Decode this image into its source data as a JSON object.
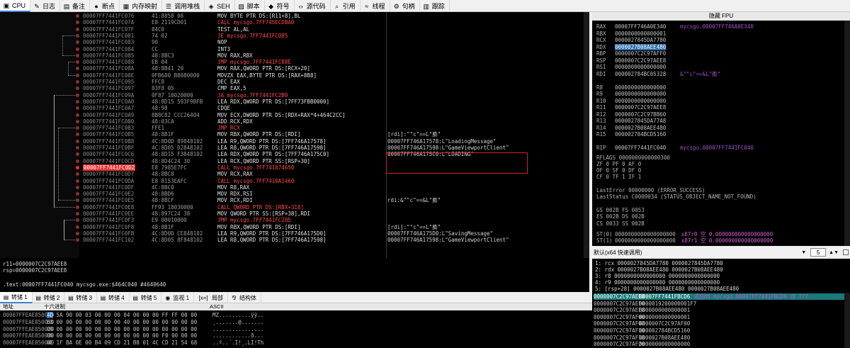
{
  "tabs": [
    {
      "label": "CPU",
      "icon": "cpu-icon",
      "glyph": "▣",
      "active": true
    },
    {
      "label": "日志",
      "icon": "log-icon",
      "glyph": "✎"
    },
    {
      "label": "备注",
      "icon": "notes-icon",
      "glyph": "▤"
    },
    {
      "label": "断点",
      "icon": "breakpoint-icon",
      "glyph": "●"
    },
    {
      "label": "内存映射",
      "icon": "memory-map-icon",
      "glyph": "▦"
    },
    {
      "label": "调用堆栈",
      "icon": "call-stack-icon",
      "glyph": "☰"
    },
    {
      "label": "SEH",
      "icon": "seh-icon",
      "glyph": "◈"
    },
    {
      "label": "脚本",
      "icon": "script-icon",
      "glyph": "▧"
    },
    {
      "label": "符号",
      "icon": "symbols-icon",
      "glyph": "◆"
    },
    {
      "label": "源代码",
      "icon": "source-icon",
      "glyph": "‹›"
    },
    {
      "label": "引用",
      "icon": "references-icon",
      "glyph": "⌕"
    },
    {
      "label": "线程",
      "icon": "threads-icon",
      "glyph": "≈"
    },
    {
      "label": "句柄",
      "icon": "handles-icon",
      "glyph": "⚙"
    },
    {
      "label": "跟踪",
      "icon": "trace-icon",
      "glyph": "▥"
    }
  ],
  "disasm": [
    {
      "addr": "00007FF7441FC076",
      "bytes": "41:8858 08",
      "asm": [
        [
          "m",
          "MOV BYTE PTR DS:[R11+8],BL"
        ]
      ],
      "cmt": ""
    },
    {
      "addr": "00007FF7441FC07A",
      "bytes": "E8 2119CD01",
      "asm": [
        [
          "red",
          "CALL mycsgo.7FF745ECDBA0"
        ]
      ],
      "cmt": ""
    },
    {
      "addr": "00007FF7441FC07F",
      "bytes": "84C0",
      "asm": [
        [
          "m",
          "TEST AL,AL"
        ]
      ],
      "cmt": ""
    },
    {
      "addr": "00007FF7441FC081",
      "bytes": "74 02",
      "asm": [
        [
          "red",
          "JE mycsgo.7FF7441FC085"
        ]
      ],
      "cmt": ""
    },
    {
      "addr": "00007FF7441FC083",
      "bytes": "90",
      "asm": [
        [
          "m",
          "NOP"
        ]
      ],
      "cmt": ""
    },
    {
      "addr": "00007FF7441FC084",
      "bytes": "CC",
      "asm": [
        [
          "m",
          "INT3"
        ]
      ],
      "cmt": ""
    },
    {
      "addr": "00007FF7441FC085",
      "bytes": "48:8BC3",
      "asm": [
        [
          "m",
          "MOV RAX,RBX"
        ]
      ],
      "cmt": ""
    },
    {
      "addr": "00007FF7441FC088",
      "bytes": "EB 04",
      "asm": [
        [
          "red",
          "JMP mycsgo.7FF7441FC08E"
        ]
      ],
      "cmt": ""
    },
    {
      "addr": "00007FF7441FC08A",
      "bytes": "48:8B41 20",
      "asm": [
        [
          "m",
          "MOV RAX,QWORD PTR DS:[RCX+20]"
        ]
      ],
      "cmt": ""
    },
    {
      "addr": "00007FF7441FC08E",
      "bytes": "0FB680 B8080000",
      "asm": [
        [
          "m",
          "MOVZX EAX,BYTE PTR DS:[RAX+8B8]"
        ]
      ],
      "cmt": ""
    },
    {
      "addr": "00007FF7441FC095",
      "bytes": "FFC8",
      "asm": [
        [
          "m",
          "DEC EAX"
        ]
      ],
      "cmt": ""
    },
    {
      "addr": "00007FF7441FC097",
      "bytes": "83F8 05",
      "asm": [
        [
          "m",
          "CMP EAX,5"
        ]
      ],
      "cmt": ""
    },
    {
      "addr": "00007FF7441FC09A",
      "bytes": "0F87 10020000",
      "asm": [
        [
          "red",
          "JA mycsgo.7FF7441FC2B0"
        ]
      ],
      "cmt": ""
    },
    {
      "addr": "00007FF7441FC0A0",
      "bytes": "48:8D15 593F9BFB",
      "asm": [
        [
          "m",
          "LEA RDX,QWORD PTR DS:[7FF73FBB0000]"
        ]
      ],
      "cmt": ""
    },
    {
      "addr": "00007FF7441FC0A7",
      "bytes": "48:98",
      "asm": [
        [
          "m",
          "CDQE"
        ]
      ],
      "cmt": ""
    },
    {
      "addr": "00007FF7441FC0A9",
      "bytes": "8B8C82 CCC26404",
      "asm": [
        [
          "m",
          "MOV ECX,DWORD PTR DS:[RDX+RAX*4+464C2CC]"
        ]
      ],
      "cmt": ""
    },
    {
      "addr": "00007FF7441FC0B0",
      "bytes": "48:03CA",
      "asm": [
        [
          "m",
          "ADD RCX,RDX"
        ]
      ],
      "cmt": ""
    },
    {
      "addr": "00007FF7441FC0B3",
      "bytes": "FFE1",
      "asm": [
        [
          "red",
          "JMP RCX"
        ]
      ],
      "cmt": ""
    },
    {
      "addr": "00007FF7441FC0B5",
      "bytes": "48:8B1F",
      "asm": [
        [
          "m",
          "MOV RBX,QWORD PTR DS:[RDI]"
        ]
      ],
      "cmt": "[rdi]:\"\"c\"==L\"膨\""
    },
    {
      "addr": "00007FF7441FC0B8",
      "bytes": "4C:8D0D 89848102",
      "asm": [
        [
          "m",
          "LEA R9,QWORD PTR DS:[7FF746A17578]"
        ]
      ],
      "cmt": "00007FF746A17578:L\"LoadingMessage\""
    },
    {
      "addr": "00007FF7441FC0BF",
      "bytes": "4C:8D05 D2848102",
      "asm": [
        [
          "m",
          "LEA R8,QWORD PTR DS:[7FF746A17598]"
        ]
      ],
      "cmt": "00007FF746A17598:L\"GameViewportClient\""
    },
    {
      "addr": "00007FF7441FC0C6",
      "bytes": "48:8D15 F3848102",
      "asm": [
        [
          "m",
          "LEA RDX,QWORD PTR DS:[7FF746A175C0]"
        ]
      ],
      "cmt": "00007FF746A175C0:L\"LOADING\""
    },
    {
      "addr": "00007FF7441FC0CD",
      "bytes": "48:8D4C24 30",
      "asm": [
        [
          "m",
          "LEA RCX,QWORD PTR SS:[RSP+30]"
        ]
      ],
      "cmt": ""
    },
    {
      "addr": "00007FF7441FC0D2",
      "bytes": "E8 7985E7FC",
      "asm": [
        [
          "red",
          "CALL mycsgo.7FF741074650"
        ]
      ],
      "cmt": "",
      "bp": true
    },
    {
      "addr": "00007FF7441FC0D7",
      "bytes": "48:8BC8",
      "asm": [
        [
          "m",
          "MOV RCX,RAX"
        ]
      ],
      "cmt": ""
    },
    {
      "addr": "00007FF7441FC0DA",
      "bytes": "E8 8153EAFC",
      "asm": [
        [
          "red",
          "CALL mycsgo.7FF7410A1460"
        ]
      ],
      "cmt": ""
    },
    {
      "addr": "00007FF7441FC0DF",
      "bytes": "4C:8BC0",
      "asm": [
        [
          "m",
          "MOV R8,RAX"
        ]
      ],
      "cmt": ""
    },
    {
      "addr": "00007FF7441FC0E2",
      "bytes": "48:8BD6",
      "asm": [
        [
          "m",
          "MOV RDX,RSI"
        ]
      ],
      "cmt": ""
    },
    {
      "addr": "00007FF7441FC0E5",
      "bytes": "48:8BCF",
      "asm": [
        [
          "m",
          "MOV RCX,RDI"
        ]
      ],
      "cmt": "rdi:&\"\"c\"==&L\"膨\""
    },
    {
      "addr": "00007FF7441FC0E8",
      "bytes": "FF93 18030000",
      "asm": [
        [
          "red",
          "CALL QWORD PTR DS:[RBX+318]"
        ]
      ],
      "cmt": ""
    },
    {
      "addr": "00007FF7441FC0EE",
      "bytes": "48:897C24 38",
      "asm": [
        [
          "m",
          "MOV QWORD PTR SS:[RSP+38],RDI"
        ]
      ],
      "cmt": ""
    },
    {
      "addr": "00007FF7441FC0F3",
      "bytes": "E9 00010000",
      "asm": [
        [
          "red",
          "JMP mycsgo.7FF7441FC205"
        ]
      ],
      "cmt": ""
    },
    {
      "addr": "00007FF7441FC0F8",
      "bytes": "48:8B1F",
      "asm": [
        [
          "m",
          "MOV RBX,QWORD PTR DS:[RDI]"
        ]
      ],
      "cmt": "[rdi]:\"\"c\"==L\"膨\""
    },
    {
      "addr": "00007FF7441FC0FB",
      "bytes": "4C:8D0D CE848102",
      "asm": [
        [
          "m",
          "LEA R9,QWORD PTR DS:[7FF746A175D0]"
        ]
      ],
      "cmt": "00007FF746A175D0:L\"SavingMessage\""
    },
    {
      "addr": "00007FF7441FC102",
      "bytes": "4C:8D05 8F848102",
      "asm": [
        [
          "m",
          "LEA R8,QWORD PTR DS:[7FF746A17598]"
        ]
      ],
      "cmt": "00007FF746A17598:L\"GameViewportClient\""
    }
  ],
  "info": [
    "r11=0000007C2C97AEE8",
    "rsp=0000007C2C97AEE8",
    "",
    ".text:00007FF7441FC040 mycsgo.exe:$464C040 #4640640"
  ],
  "regs_header": "隐藏 FPU",
  "regs": [
    {
      "n": "RAX",
      "v": "00007FF746A0E340",
      "c": "mycsgo.00007FF746A0E340"
    },
    {
      "n": "RBX",
      "v": "0000000000000001",
      "c": ""
    },
    {
      "n": "RCX",
      "v": "0000027845DA7780",
      "c": ""
    },
    {
      "n": "RDX",
      "v": "0000027B08AEE480",
      "c": "",
      "hl": true
    },
    {
      "n": "RBP",
      "v": "0000007C2C97AFF0",
      "c": ""
    },
    {
      "n": "RSP",
      "v": "0000007C2C97AEE8",
      "c": ""
    },
    {
      "n": "RSI",
      "v": "0000000000000000",
      "c": ""
    },
    {
      "n": "RDI",
      "v": "000002784BC05328",
      "c": "&\"\"c\"==&L\"膨\""
    },
    {
      "n": "",
      "v": "",
      "c": ""
    },
    {
      "n": "R8",
      "v": "0000000000000000",
      "c": ""
    },
    {
      "n": "R9",
      "v": "0000000000000000",
      "c": ""
    },
    {
      "n": "R10",
      "v": "0000000000000000",
      "c": ""
    },
    {
      "n": "R11",
      "v": "0000007C2C97AEE8",
      "c": ""
    },
    {
      "n": "R12",
      "v": "0000007C2C97BB60",
      "c": ""
    },
    {
      "n": "R13",
      "v": "0000027845DA77A8",
      "c": ""
    },
    {
      "n": "R14",
      "v": "0000027B08AEE480",
      "c": ""
    },
    {
      "n": "R15",
      "v": "000002784BCD5160",
      "c": ""
    },
    {
      "n": "",
      "v": "",
      "c": ""
    },
    {
      "n": "RIP",
      "v": "00007FF7441FC040",
      "c": "mycsgo.00007FF7441FC040"
    }
  ],
  "flags": [
    "RFLAGS   0000000000000300",
    "ZF 0  PF 0  AF 0",
    "OF 0  SF 0  DF 0",
    "CF 0  TF 1  IF 1",
    "",
    "LastError  00000000 (ERROR_SUCCESS)",
    "LastStatus C0000034 (STATUS_OBJECT_NAME_NOT_FOUND)",
    "",
    "GS 002B  FS 0053",
    "ES 002B  DS 002B",
    "CS 0033  SS 002B"
  ],
  "st": [
    {
      "n": "ST(0)",
      "v": "0000000000000000000",
      "s": "x87r0 空 0.000000000000000000"
    },
    {
      "n": "ST(1)",
      "v": "0000000000000000000",
      "s": "x87r1 空 0.000000000000000000"
    }
  ],
  "callconv": {
    "label": "默认(x64 快速调用)",
    "spin": "5"
  },
  "args": [
    "1: rcx 0000027845DA7780 0000027845DA7780",
    "2: rdx 0000027B08AEE480 0000027B08AEE480",
    "3: r8 0000000000000000 0000000000000000",
    "4: r9 0000000000000000 0000000000000000",
    "5: [rsp+28] 0000027B08AEE480 0000027B08AEE480"
  ],
  "btabs": [
    {
      "label": "转储 1",
      "icon": "dump-icon",
      "glyph": "▤",
      "active": true
    },
    {
      "label": "转储 2",
      "icon": "dump-icon",
      "glyph": "▤"
    },
    {
      "label": "转储 3",
      "icon": "dump-icon",
      "glyph": "▤"
    },
    {
      "label": "转储 4",
      "icon": "dump-icon",
      "glyph": "▤"
    },
    {
      "label": "转储 5",
      "icon": "dump-icon",
      "glyph": "▤"
    },
    {
      "label": "监视 1",
      "icon": "watch-icon",
      "glyph": "◉"
    },
    {
      "label": "局部",
      "icon": "locals-icon",
      "glyph": "[x=]"
    },
    {
      "label": "结构体",
      "icon": "struct-icon",
      "glyph": "⅋"
    }
  ],
  "dump_head": {
    "addr": "地址",
    "hex": "十六进制",
    "ascii": "ASCII"
  },
  "dump": [
    {
      "a": "00007FFEAE850000",
      "h1": "4D",
      "h": " 5A 90 00 03 00 00 00 04 00 00 00 FF FF 00 00",
      "c": "MZ..........ÿÿ.."
    },
    {
      "a": "00007FFEAE850010",
      "h1": "",
      "h": "B8 00 00 00 00 00 00 00 40 00 00 00 00 00 00 00",
      "c": "¸.......@......."
    },
    {
      "a": "00007FFEAE850020",
      "h1": "",
      "h": "00 00 00 00 00 00 00 00 00 00 00 00 00 00 00 00",
      "c": "................"
    },
    {
      "a": "00007FFEAE850030",
      "h1": "",
      "h": "00 00 00 00 00 00 00 00 00 00 00 00 F0 00 00 00",
      "c": "............ð..."
    },
    {
      "a": "00007FFEAE850040",
      "h1": "",
      "h": "0E 1F BA 0E 00 B4 09 CD 21 B8 01 4C CD 21 54 68",
      "c": "..º..´.Í!¸.LÍ!Th"
    }
  ],
  "stack": [
    {
      "a": "0000007C2C97AEE8",
      "v": "00007FF7441FBCD6",
      "c": "返回到 mycsgo.00007FF7441FBCD6 自 ???",
      "hl": true
    },
    {
      "a": "0000007C2C97AEF0",
      "v": "0000019200000001F7",
      "c": ""
    },
    {
      "a": "0000007C2C97AEF8",
      "v": "0000000000000001",
      "c": ""
    },
    {
      "a": "0000007C2C97AF00",
      "v": "0000000000000001",
      "c": ""
    },
    {
      "a": "0000007C2C97AF08",
      "v": "0000007C2C97AF00",
      "c": ""
    },
    {
      "a": "0000007C2C97AF10",
      "v": "000002784BCD5160",
      "c": ""
    },
    {
      "a": "0000007C2C97AF18",
      "v": "0000027B08AEE480",
      "c": ""
    },
    {
      "a": "0000007C2C97AF20",
      "v": "0000000000000000",
      "c": ""
    }
  ]
}
